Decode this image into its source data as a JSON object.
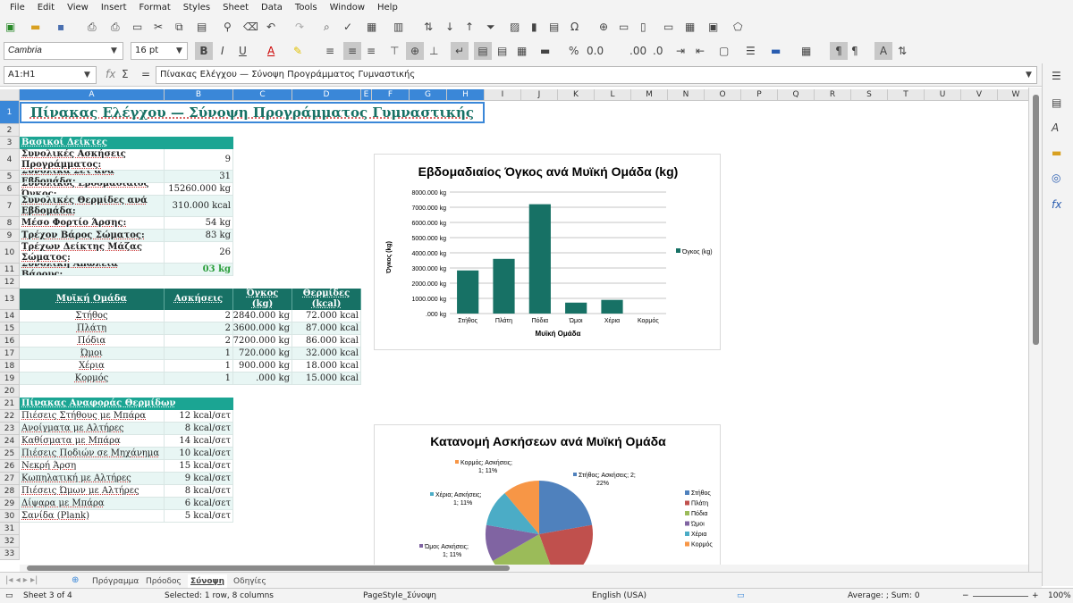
{
  "menu": [
    "File",
    "Edit",
    "View",
    "Insert",
    "Format",
    "Styles",
    "Sheet",
    "Data",
    "Tools",
    "Window",
    "Help"
  ],
  "toolbar": {
    "font_name": "Cambria",
    "font_size": "16 pt"
  },
  "formula": {
    "name_box": "A1:H1",
    "content": "Πίνακας Ελέγχου — Σύνοψη Προγράμματος Γυμναστικής"
  },
  "columns": [
    "A",
    "B",
    "C",
    "D",
    "E",
    "F",
    "G",
    "H",
    "I",
    "J",
    "K",
    "L",
    "M",
    "N",
    "O",
    "P",
    "Q",
    "R",
    "S",
    "T",
    "U",
    "V",
    "W"
  ],
  "rows": [
    "1",
    "2",
    "3",
    "4",
    "5",
    "6",
    "7",
    "8",
    "9",
    "10",
    "11",
    "12",
    "13",
    "14",
    "15",
    "16",
    "17",
    "18",
    "19",
    "20",
    "21",
    "22",
    "23",
    "24",
    "25",
    "26",
    "27",
    "28",
    "29",
    "30",
    "31",
    "32",
    "33"
  ],
  "sheet_title": "Πίνακας Ελέγχου — Σύνοψη Προγράμματος Γυμναστικής",
  "kpi": {
    "header": "Βασικοί Δείκτες",
    "items": [
      {
        "label": "Συνολικές Ασκήσεις Προγράμματος:",
        "value": "9"
      },
      {
        "label": "Συνολικά Σετ ανά Εβδομάδα:",
        "value": "31"
      },
      {
        "label": "Συνολικός Εβδομαδιαίος Όγκος:",
        "value": "15260.000 kg"
      },
      {
        "label": "Συνολικές Θερμίδες ανά Εβδομάδα:",
        "value": "310.000 kcal"
      },
      {
        "label": "Μέσο Φορτίο Άρσης:",
        "value": "54 kg"
      },
      {
        "label": "Τρέχον Βάρος Σώματος:",
        "value": "83 kg"
      },
      {
        "label": "Τρέχων Δείκτης Μάζας Σώματος:",
        "value": "26"
      },
      {
        "label": "Συνολική Απώλεια Βάρους:",
        "value": "03 kg"
      }
    ]
  },
  "muscle_table": {
    "headers": [
      "Μυϊκή Ομάδα",
      "Ασκήσεις",
      "Όγκος (kg)",
      "Θερμίδες (kcal)"
    ],
    "rows": [
      [
        "Στήθος",
        "2",
        "2840.000 kg",
        "72.000 kcal"
      ],
      [
        "Πλάτη",
        "2",
        "3600.000 kg",
        "87.000 kcal"
      ],
      [
        "Πόδια",
        "2",
        "7200.000 kg",
        "86.000 kcal"
      ],
      [
        "Ώμοι",
        "1",
        "720.000 kg",
        "32.000 kcal"
      ],
      [
        "Χέρια",
        "1",
        "900.000 kg",
        "18.000 kcal"
      ],
      [
        "Κορμός",
        "1",
        ".000 kg",
        "15.000 kcal"
      ]
    ]
  },
  "calorie_table": {
    "header": "Πίνακας Αναφοράς Θερμίδων",
    "rows": [
      [
        "Πιέσεις Στήθους με Μπάρα",
        "12 kcal/σετ"
      ],
      [
        "Ανοίγματα με Αλτήρες",
        "8 kcal/σετ"
      ],
      [
        "Καθίσματα με Μπάρα",
        "14 kcal/σετ"
      ],
      [
        "Πιέσεις Ποδιών σε Μηχάνημα",
        "10 kcal/σετ"
      ],
      [
        "Νεκρή Άρση",
        "15 kcal/σετ"
      ],
      [
        "Κωπηλατική με Αλτήρες",
        "9 kcal/σετ"
      ],
      [
        "Πιέσεις Ώμων με Αλτήρες",
        "8 kcal/σετ"
      ],
      [
        "Δίψαρα με Μπάρα",
        "6 kcal/σετ"
      ],
      [
        "Σανίδα (Plank)",
        "5 kcal/σετ"
      ]
    ]
  },
  "chart_data": [
    {
      "type": "bar",
      "title": "Εβδομαδιαίος Όγκος ανά Μυϊκή Ομάδα (kg)",
      "xlabel": "Μυϊκή Ομάδα",
      "ylabel": "Όγκος (kg)",
      "categories": [
        "Στήθος",
        "Πλάτη",
        "Πόδια",
        "Ώμοι",
        "Χέρια",
        "Κορμός"
      ],
      "series": [
        {
          "name": "Όγκος (kg)",
          "values": [
            2840,
            3600,
            7200,
            720,
            900,
            0
          ]
        }
      ],
      "ylim": [
        0,
        8000
      ],
      "yticks": [
        "8000.000 kg",
        "7000.000 kg",
        "6000.000 kg",
        "5000.000 kg",
        "4000.000 kg",
        "3000.000 kg",
        "2000.000 kg",
        "1000.000 kg",
        ".000 kg"
      ],
      "legend": "right",
      "color": "#177165"
    },
    {
      "type": "pie",
      "title": "Κατανομή Ασκήσεων ανά Μυϊκή Ομάδα",
      "categories": [
        "Στήθος",
        "Πλάτη",
        "Πόδια",
        "Ώμοι",
        "Χέρια",
        "Κορμός"
      ],
      "values": [
        2,
        2,
        2,
        1,
        1,
        1
      ],
      "colors": [
        "#4f81bd",
        "#c0504d",
        "#9bbb59",
        "#8064a2",
        "#4bacc6",
        "#f79646"
      ],
      "labels": [
        "Στήθος; Ασκήσεις; 2; 22%",
        "Ώμοι; Ασκήσεις; 1; 11%",
        "Χέρια; Ασκήσεις; 1; 11%",
        "Κορμός; Ασκήσεις; 1; 11%"
      ],
      "legend": "right"
    }
  ],
  "sheet_tabs": [
    "Πρόγραμμα",
    "Πρόοδος",
    "Σύνοψη",
    "Οδηγίες"
  ],
  "active_tab": "Σύνοψη",
  "status": {
    "sheet": "Sheet 3 of 4",
    "selection": "Selected: 1 row, 8 columns",
    "pagestyle": "PageStyle_Σύνοψη",
    "lang": "English (USA)",
    "sum": "Average: ; Sum: 0",
    "zoom": "100%"
  }
}
